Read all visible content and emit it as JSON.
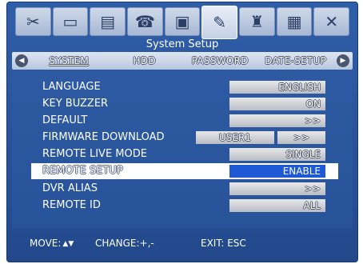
{
  "window": {
    "title": "System Setup"
  },
  "icon_tabs": [
    {
      "name": "tools-icon",
      "glyph": "✂"
    },
    {
      "name": "monitor-icon",
      "glyph": "▭"
    },
    {
      "name": "storage-icon",
      "glyph": "▤"
    },
    {
      "name": "network-icon",
      "glyph": "☎"
    },
    {
      "name": "record-icon",
      "glyph": "▣"
    },
    {
      "name": "system-setup-icon",
      "glyph": "✎"
    },
    {
      "name": "event-icon",
      "glyph": "♜"
    },
    {
      "name": "display-icon",
      "glyph": "▦"
    },
    {
      "name": "close-icon",
      "glyph": "✕"
    }
  ],
  "subtabs": {
    "left_arrow": "◀",
    "right_arrow": "▶",
    "items": [
      "SYSTEM",
      "HDD",
      "PASSWORD",
      "DATE-SETUP"
    ]
  },
  "settings": [
    {
      "label": "LANGUAGE",
      "value": "ENGLISH"
    },
    {
      "label": "KEY BUZZER",
      "value": "ON"
    },
    {
      "label": "DEFAULT",
      "value": ">>"
    },
    {
      "label": "FIRMWARE DOWNLOAD",
      "value": "USER1",
      "value2": ">>"
    },
    {
      "label": "REMOTE LIVE MODE",
      "value": "SINGLE"
    },
    {
      "label": "REMOTE SETUP",
      "value": "ENABLE"
    },
    {
      "label": "DVR ALIAS",
      "value": ">>"
    },
    {
      "label": "REMOTE ID",
      "value": "ALL"
    }
  ],
  "footer": {
    "move": "MOVE:",
    "move_glyph": "▲▼",
    "change": "CHANGE:+,-",
    "exit": "EXIT: ESC"
  }
}
